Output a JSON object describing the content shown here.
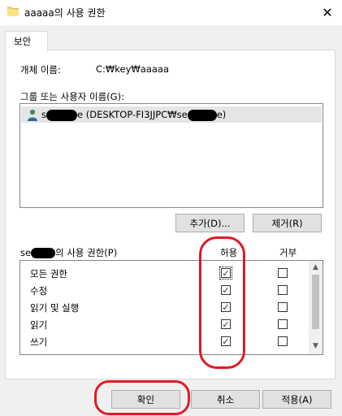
{
  "window": {
    "title": "aaaaa의 사용 권한",
    "close_label": "✕"
  },
  "tabs": [
    {
      "label": "보안"
    }
  ],
  "object": {
    "label": "개체 이름:",
    "value": "C:₩key₩aaaaa"
  },
  "groups": {
    "label": "그룹 또는 사용자 이름(G):",
    "items": [
      {
        "prefix": "s",
        "suffix": "e (DESKTOP-FI3JJPC₩se",
        "tail": "e)"
      }
    ],
    "add_label": "추가(D)...",
    "remove_label": "제거(R)"
  },
  "permissions": {
    "label_prefix": "se",
    "label_suffix": "의 사용 권한(P)",
    "allow_header": "허용",
    "deny_header": "거부",
    "rows": [
      {
        "name": "모든 권한",
        "allow": true,
        "deny": false
      },
      {
        "name": "수정",
        "allow": true,
        "deny": false
      },
      {
        "name": "읽기 및 실행",
        "allow": true,
        "deny": false
      },
      {
        "name": "읽기",
        "allow": true,
        "deny": false
      },
      {
        "name": "쓰기",
        "allow": true,
        "deny": false
      }
    ]
  },
  "buttons": {
    "ok": "확인",
    "cancel": "취소",
    "apply": "적용(A)"
  },
  "icons": {
    "folder": "folder-icon",
    "user": "user-icon",
    "scroll_up": "▲",
    "scroll_down": "▼"
  },
  "colors": {
    "highlight": "#e01b24",
    "selected_row": "#e5e5e5"
  }
}
